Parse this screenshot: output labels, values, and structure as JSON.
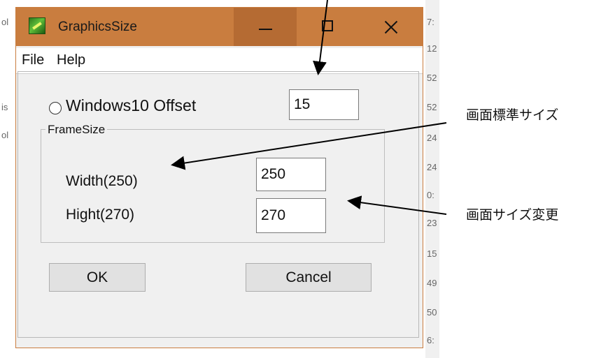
{
  "window": {
    "title": "GraphicsSize"
  },
  "menu": {
    "file": "File",
    "help": "Help"
  },
  "offset": {
    "label": "Windows10 Offset",
    "value": "15"
  },
  "frame_group": {
    "title": "FrameSize",
    "width_label": "Width(250)",
    "width_value": "250",
    "height_label": "Hight(270)",
    "height_value": "270"
  },
  "buttons": {
    "ok": "OK",
    "cancel": "Cancel"
  },
  "annotations": {
    "standard_size": "画面標準サイズ",
    "size_change": "画面サイズ変更"
  },
  "background_fragments": {
    "left": [
      "ol",
      "is",
      "ol"
    ],
    "right": [
      "7:",
      "12",
      "52",
      "52",
      "24",
      "24",
      "0:",
      "23",
      "15",
      "49",
      "50",
      "6:"
    ]
  }
}
